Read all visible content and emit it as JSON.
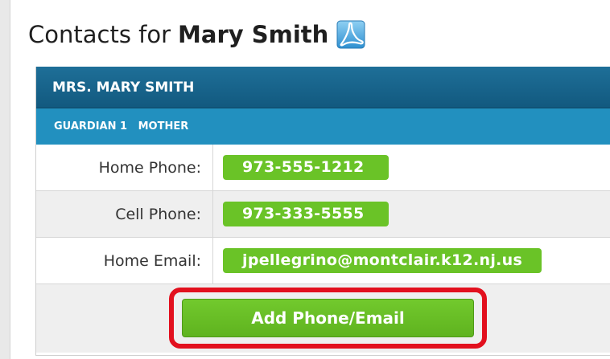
{
  "page": {
    "title_prefix": "Contacts for",
    "title_name": "Mary Smith",
    "pdf_icon": "pdf-export-icon"
  },
  "contact": {
    "header": "MRS. MARY SMITH",
    "subheader": "GUARDIAN 1   MOTHER",
    "rows": [
      {
        "label": "Home Phone:",
        "value": "973-555-1212"
      },
      {
        "label": "Cell Phone:",
        "value": "973-333-5555"
      },
      {
        "label": "Home Email:",
        "value": "jpellegrino@montclair.k12.nj.us"
      }
    ],
    "add_button_label": "Add Phone/Email"
  },
  "colors": {
    "header_bg": "#12597f",
    "subheader_bg": "#2290bf",
    "pill_green": "#6ac327",
    "highlight_red": "#e2101e"
  }
}
